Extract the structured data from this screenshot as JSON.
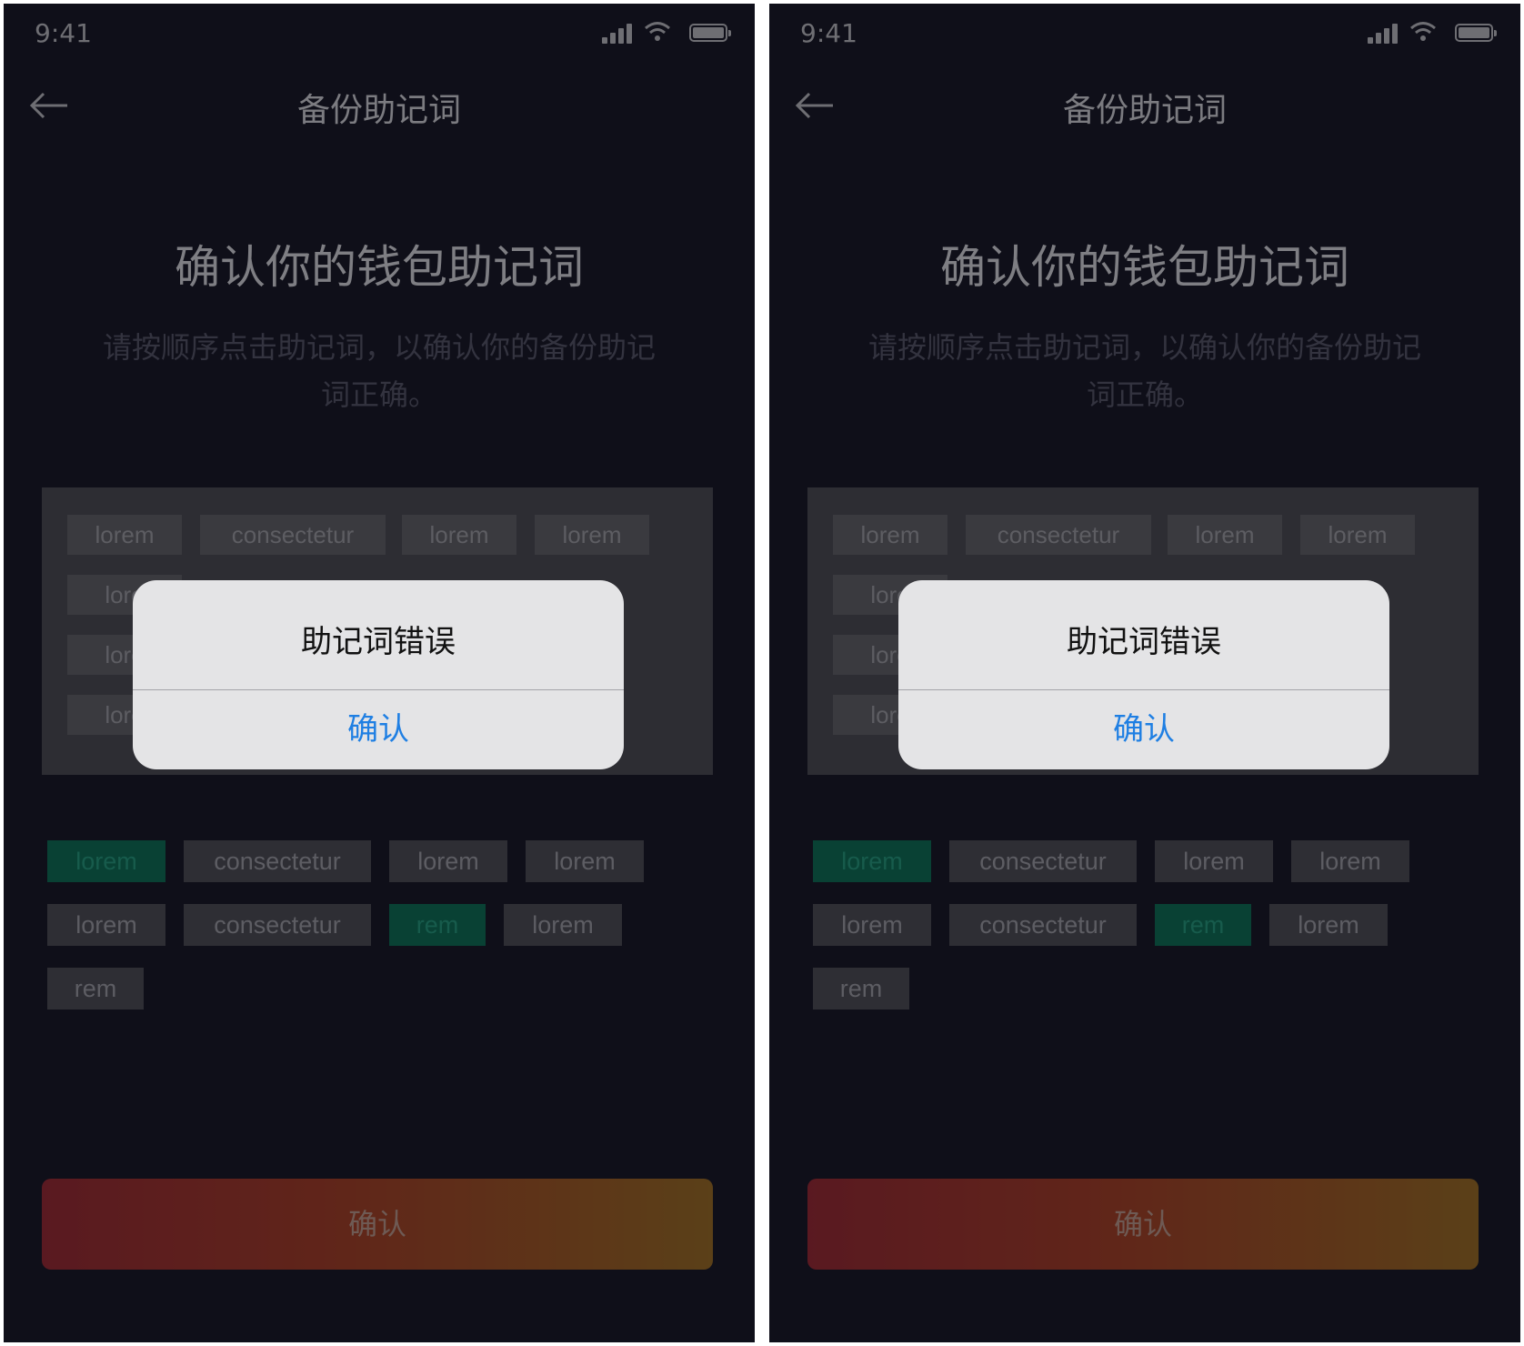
{
  "screens": [
    {
      "status_time": "9:41",
      "nav_title": "备份助记词",
      "heading": "确认你的钱包助记词",
      "subtext_line1": "请按顺序点击助记词，以确认你的备份助记",
      "subtext_line2": "词正确。",
      "selected_words": [
        "lorem",
        "consectetur",
        "lorem",
        "lorem",
        "lore",
        "lore",
        "lore"
      ],
      "word_bank": [
        "lorem",
        "consectetur",
        "lorem",
        "lorem",
        "lorem",
        "consectetur",
        "rem",
        "lorem",
        "rem"
      ],
      "confirm_label": "确认",
      "alert": {
        "title": "助记词错误",
        "button": "确认"
      }
    },
    {
      "status_time": "9:41",
      "nav_title": "备份助记词",
      "heading": "确认你的钱包助记词",
      "subtext_line1": "请按顺序点击助记词，以确认你的备份助记",
      "subtext_line2": "词正确。",
      "selected_words": [
        "lorem",
        "consectetur",
        "lorem",
        "lorem",
        "lore",
        "lore",
        "lore"
      ],
      "word_bank": [
        "lorem",
        "consectetur",
        "lorem",
        "lorem",
        "lorem",
        "consectetur",
        "rem",
        "lorem",
        "rem"
      ],
      "confirm_label": "确认",
      "alert": {
        "title": "助记词错误",
        "button": "确认"
      }
    }
  ],
  "colors": {
    "background": "#1c1c2e",
    "accent_blue": "#1f7fe3",
    "chip_green": "#11775f",
    "gradient_start": "#a42f3c",
    "gradient_end": "#a6752c"
  }
}
